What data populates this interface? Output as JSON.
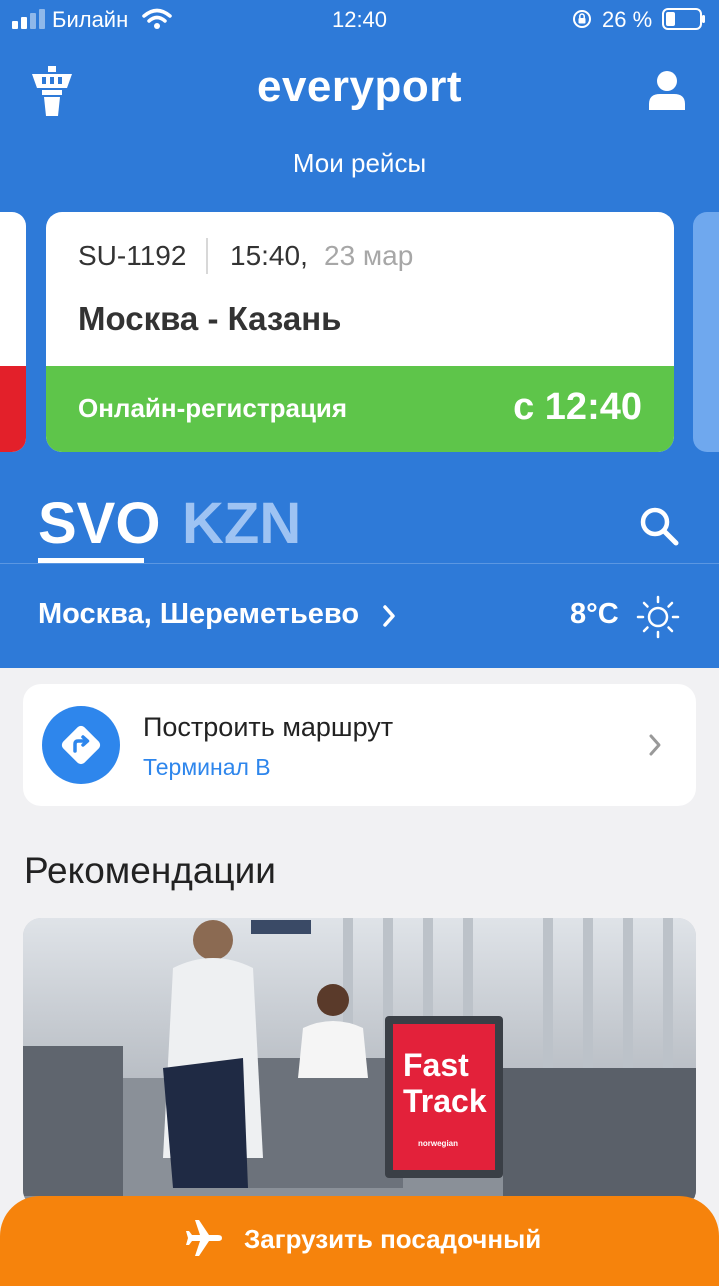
{
  "status_bar": {
    "carrier": "Билайн",
    "time": "12:40",
    "battery_percent": "26 %"
  },
  "header": {
    "logo": "everyport",
    "subtitle": "Мои рейсы",
    "left_icon": "airport-tower-icon",
    "right_icon": "profile-icon"
  },
  "flight_card": {
    "flight_number": "SU-1192",
    "time": "15:40,",
    "date": "23 мар",
    "route": "Москва - Казань",
    "checkin_label": "Онлайн-регистрация",
    "checkin_time": "с 12:40"
  },
  "airport_tabs": [
    {
      "code": "SVO",
      "active": true
    },
    {
      "code": "KZN",
      "active": false
    }
  ],
  "airport_info": {
    "name": "Москва, Шереметьево",
    "temperature": "8°C",
    "weather_icon": "sun-icon"
  },
  "route_card": {
    "title": "Построить маршрут",
    "subtitle": "Терминал B"
  },
  "recommendations": {
    "title": "Рекомендации",
    "image_sign_text": [
      "Fast",
      "Track"
    ],
    "image_sign_brand": "norwegian"
  },
  "bottom_button": {
    "label": "Загрузить посадочный"
  },
  "colors": {
    "primary_blue": "#2e7ad8",
    "checkin_green": "#5ec54a",
    "accent_orange": "#f6830c",
    "link_blue": "#2e86ec"
  }
}
